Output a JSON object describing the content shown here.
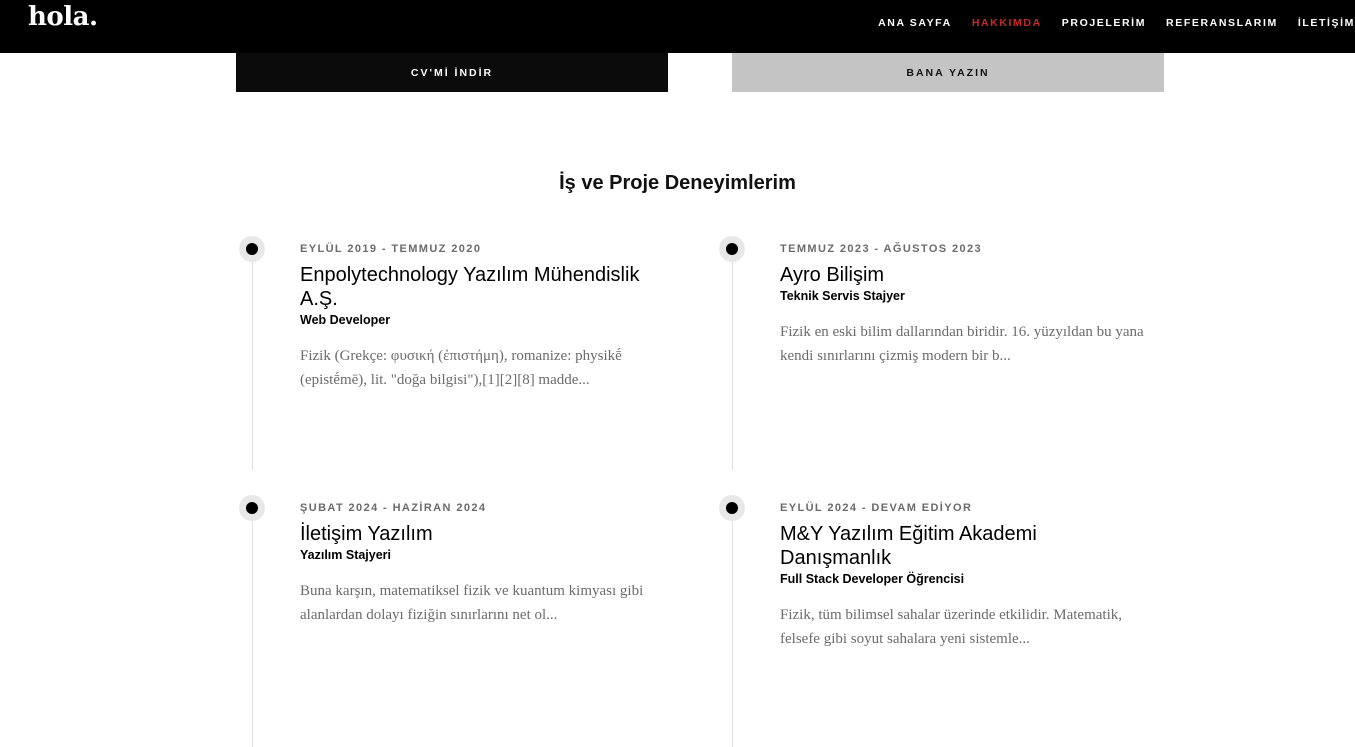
{
  "header": {
    "logo": "hola.",
    "nav": [
      {
        "label": "ANA SAYFA",
        "active": false
      },
      {
        "label": "HAKKIMDA",
        "active": true
      },
      {
        "label": "PROJELERİM",
        "active": false
      },
      {
        "label": "REFERANSLARIM",
        "active": false
      },
      {
        "label": "İLETİŞİM",
        "active": false
      }
    ]
  },
  "buttons": {
    "cv": "CV'Mİ İNDİR",
    "write": "BANA YAZIN"
  },
  "section": {
    "title": "İş ve Proje Deneyimlerim"
  },
  "experiences": [
    {
      "date": "EYLÜL 2019 - TEMMUZ 2020",
      "title": "Enpolytechnology Yazılım Mühendislik A.Ş.",
      "role": "Web Developer",
      "description": "Fizik (Grekçe: φυσική (ἐπιστήμη), romanize: physikḗ (epistḗmē), lit. \"doğa bilgisi\"),[1][2][8] madde..."
    },
    {
      "date": "TEMMUZ 2023 - AĞUSTOS 2023",
      "title": "Ayro Bilişim",
      "role": "Teknik Servis Stajyer",
      "description": "Fizik en eski bilim dallarından biridir. 16. yüzyıldan bu yana kendi sınırlarını çizmiş modern bir b..."
    },
    {
      "date": "ŞUBAT 2024 - HAZİRAN 2024",
      "title": "İletişim Yazılım",
      "role": "Yazılım Stajyeri",
      "description": "Buna karşın, matematiksel fizik ve kuantum kimyası gibi alanlardan dolayı fiziğin sınırlarını net ol..."
    },
    {
      "date": "EYLÜL 2024 - DEVAM EDİYOR",
      "title": "M&Y Yazılım Eğitim Akademi Danışmanlık",
      "role": "Full Stack Developer Öğrencisi",
      "description": "Fizik, tüm bilimsel sahalar üzerinde etkilidir. Matematik, felsefe gibi soyut sahalara yeni sistemle..."
    }
  ],
  "colors": {
    "header_bg": "#000000",
    "active_nav": "#c42b2b",
    "primary_button": "#0b0b0b",
    "secondary_button": "#c4c4c4"
  }
}
